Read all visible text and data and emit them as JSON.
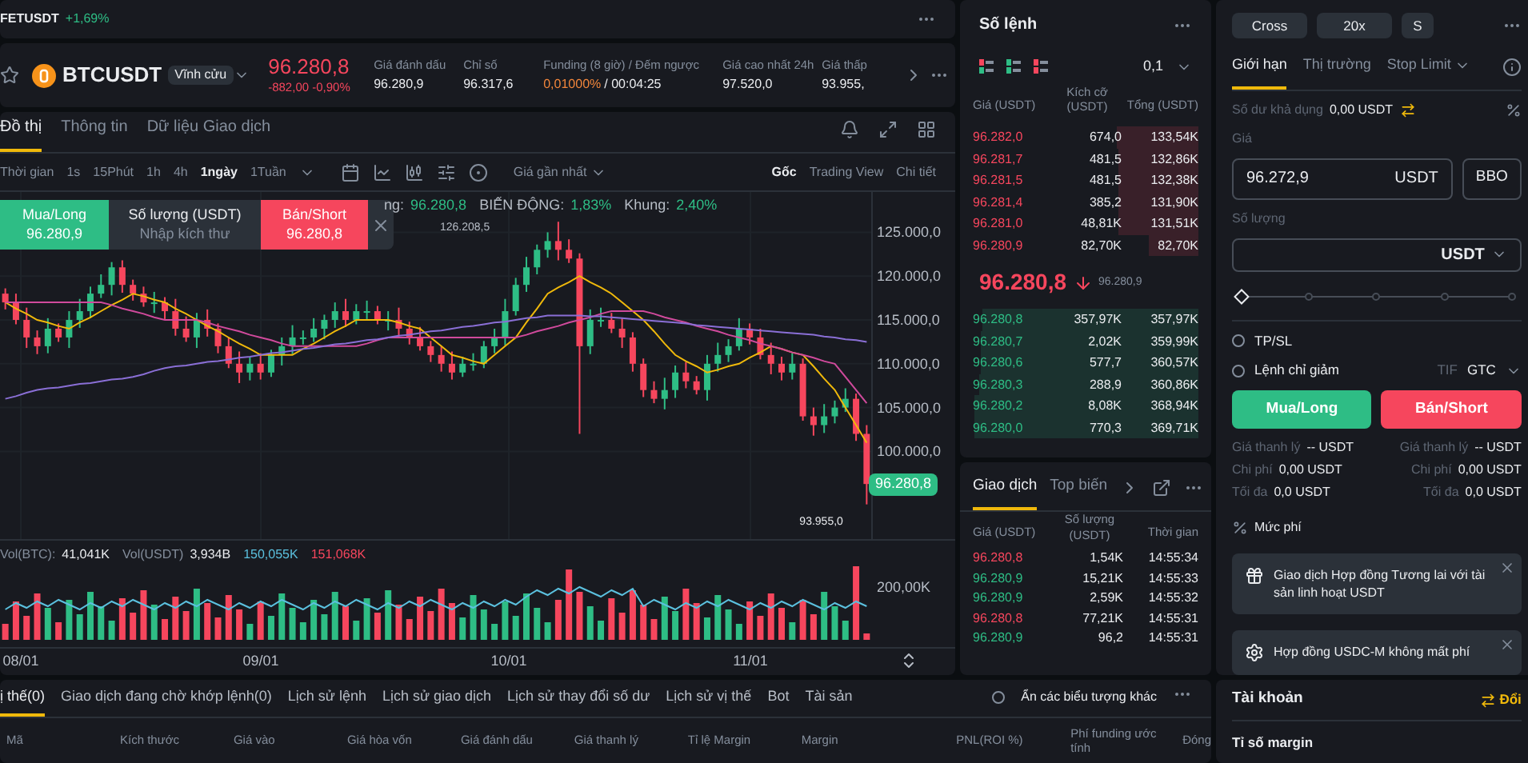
{
  "ticker_strip": {
    "symbol": "FETUSDT",
    "change": "+1,69%"
  },
  "header": {
    "symbol": "BTCUSDT",
    "contract": "Vĩnh cửu",
    "price": "96.280,8",
    "change": "-882,00 -0,90%",
    "stats": [
      {
        "label": "Giá đánh dấu",
        "value": "96.280,9"
      },
      {
        "label": "Chỉ số",
        "value": "96.317,6"
      },
      {
        "label": "Funding (8 giờ) / Đếm ngược",
        "value": "0,01000%",
        "countdown": "/ 00:04:25"
      },
      {
        "label": "Giá cao nhất 24h",
        "value": "97.520,0"
      },
      {
        "label": "Giá thấp",
        "value": "93.955,"
      }
    ]
  },
  "chart_tabs": [
    {
      "label": "Đồ thị",
      "selected": true
    },
    {
      "label": "Thông tin",
      "selected": false
    },
    {
      "label": "Dữ liệu Giao dịch",
      "selected": false
    }
  ],
  "intervals": [
    {
      "label": "Thời gian",
      "selected": false
    },
    {
      "label": "1s",
      "selected": false
    },
    {
      "label": "15Phút",
      "selected": false
    },
    {
      "label": "1h",
      "selected": false
    },
    {
      "label": "4h",
      "selected": false
    },
    {
      "label": "1ngày",
      "selected": true
    },
    {
      "label": "1Tuần",
      "selected": false
    }
  ],
  "price_source": "Giá gần nhất",
  "views": [
    {
      "label": "Gốc",
      "selected": true
    },
    {
      "label": "Trading View",
      "selected": false
    },
    {
      "label": "Chi tiết",
      "selected": false
    }
  ],
  "quick_trade": {
    "buy_label": "Mua/Long",
    "buy_price": "96.280,9",
    "qty_label": "Số lượng (USDT)",
    "qty_placeholder": "Nhập kích thư",
    "sell_label": "Bán/Short",
    "sell_price": "96.280,8"
  },
  "chart_legend": [
    {
      "label": "ng:",
      "value": "96.280,8"
    },
    {
      "label": "BIẾN ĐỘNG:",
      "value": "1,83%"
    },
    {
      "label": "Khung:",
      "value": "2,40%"
    }
  ],
  "chart_data": {
    "type": "candlestick",
    "grid": true,
    "ylim": [
      90000,
      129600
    ],
    "yticks": [
      {
        "value": 125000,
        "label": "125.000,0"
      },
      {
        "value": 120000,
        "label": "120.000,0"
      },
      {
        "value": 115000,
        "label": "115.000,0"
      },
      {
        "value": 110000,
        "label": "110.000,0"
      },
      {
        "value": 105000,
        "label": "105.000,0"
      },
      {
        "value": 100000,
        "label": "100.000,0"
      }
    ],
    "ohlc": [
      [
        118000,
        118600,
        116200,
        117000
      ],
      [
        117000,
        118000,
        114500,
        115000
      ],
      [
        115000,
        116400,
        111800,
        113000
      ],
      [
        113000,
        113800,
        111100,
        112000
      ],
      [
        112000,
        115200,
        111200,
        114000
      ],
      [
        114000,
        114600,
        112500,
        113000
      ],
      [
        113000,
        116000,
        111800,
        115000
      ],
      [
        115000,
        117400,
        114100,
        116000
      ],
      [
        116000,
        118800,
        115200,
        118000
      ],
      [
        118000,
        120200,
        117500,
        119000
      ],
      [
        119000,
        121600,
        117800,
        121000
      ],
      [
        121000,
        121800,
        118100,
        119000
      ],
      [
        119000,
        119600,
        117200,
        118000
      ],
      [
        118000,
        118800,
        116500,
        117000
      ],
      [
        117000,
        118200,
        115800,
        117000
      ],
      [
        117000,
        117600,
        115100,
        116000
      ],
      [
        116000,
        117400,
        113200,
        114000
      ],
      [
        114000,
        115400,
        112500,
        113000
      ],
      [
        113000,
        115800,
        111800,
        115000
      ],
      [
        115000,
        116200,
        113100,
        114000
      ],
      [
        114000,
        114600,
        111200,
        112000
      ],
      [
        112000,
        113000,
        109500,
        110000
      ],
      [
        110000,
        111400,
        107800,
        109000
      ],
      [
        109000,
        110800,
        108100,
        110000
      ],
      [
        110000,
        111200,
        108200,
        109000
      ],
      [
        109000,
        111600,
        108500,
        111000
      ],
      [
        111000,
        113000,
        109800,
        112000
      ],
      [
        112000,
        114400,
        111100,
        113000
      ],
      [
        113000,
        113800,
        112200,
        113000
      ],
      [
        113000,
        115200,
        112500,
        114000
      ],
      [
        114000,
        115600,
        112800,
        115000
      ],
      [
        115000,
        117000,
        114100,
        116000
      ],
      [
        116000,
        117400,
        114200,
        115000
      ],
      [
        115000,
        116800,
        114500,
        116000
      ],
      [
        116000,
        117200,
        115100,
        116000
      ],
      [
        116000,
        116600,
        114500,
        115000
      ],
      [
        115000,
        116000,
        113800,
        115000
      ],
      [
        115000,
        116400,
        113100,
        114000
      ],
      [
        114000,
        114800,
        112200,
        113000
      ],
      [
        113000,
        114200,
        111500,
        112000
      ],
      [
        112000,
        112600,
        110200,
        111000
      ],
      [
        111000,
        112000,
        109100,
        110000
      ],
      [
        110000,
        111400,
        108200,
        109000
      ],
      [
        109000,
        110800,
        108500,
        110000
      ],
      [
        110000,
        111200,
        109200,
        110000
      ],
      [
        110000,
        112600,
        109500,
        112000
      ],
      [
        112000,
        114000,
        111200,
        113000
      ],
      [
        113000,
        117400,
        112100,
        116000
      ],
      [
        116000,
        119800,
        115500,
        119000
      ],
      [
        119000,
        122200,
        118200,
        121000
      ],
      [
        121000,
        123600,
        120200,
        123000
      ],
      [
        123000,
        125000,
        122100,
        124000
      ],
      [
        124000,
        126200,
        121800,
        123000
      ],
      [
        123000,
        124200,
        121500,
        122000
      ],
      [
        122000,
        122600,
        102000,
        112000
      ],
      [
        112000,
        116200,
        111100,
        115000
      ],
      [
        115000,
        116400,
        114200,
        115000
      ],
      [
        115000,
        115800,
        113500,
        114000
      ],
      [
        114000,
        115200,
        111800,
        113000
      ],
      [
        113000,
        113600,
        109100,
        110000
      ],
      [
        110000,
        110600,
        106200,
        107000
      ],
      [
        107000,
        108000,
        105500,
        106000
      ],
      [
        106000,
        108400,
        104800,
        107000
      ],
      [
        107000,
        109800,
        106100,
        109000
      ],
      [
        109000,
        110200,
        107200,
        108000
      ],
      [
        108000,
        108600,
        106500,
        107000
      ],
      [
        107000,
        111000,
        105800,
        110000
      ],
      [
        110000,
        112400,
        109100,
        111000
      ],
      [
        111000,
        112800,
        110200,
        112000
      ],
      [
        112000,
        115200,
        111500,
        114000
      ],
      [
        114000,
        114600,
        112200,
        113000
      ],
      [
        113000,
        114000,
        110500,
        111000
      ],
      [
        111000,
        112400,
        108800,
        110000
      ],
      [
        110000,
        110800,
        108100,
        109000
      ],
      [
        109000,
        111200,
        108200,
        110000
      ],
      [
        110000,
        110600,
        103500,
        104000
      ],
      [
        104000,
        105000,
        101800,
        103000
      ],
      [
        103000,
        105400,
        102100,
        104000
      ],
      [
        104000,
        105800,
        103200,
        105000
      ],
      [
        105000,
        107200,
        104500,
        106000
      ],
      [
        106000,
        106600,
        101200,
        102000
      ],
      [
        102000,
        103000,
        93955,
        96280.8
      ]
    ],
    "series": [
      {
        "type": "line",
        "color": "#f0b90b",
        "values": [
          117000,
          116300,
          115700,
          115000,
          114700,
          114300,
          114000,
          114700,
          115300,
          116000,
          116700,
          117300,
          118000,
          117700,
          117300,
          117000,
          116300,
          115700,
          115000,
          114300,
          113700,
          113000,
          112300,
          111700,
          111000,
          111000,
          111000,
          111000,
          111700,
          112300,
          113000,
          113700,
          114300,
          115000,
          115000,
          115000,
          115000,
          114700,
          114300,
          114000,
          113000,
          112000,
          111000,
          110700,
          110300,
          110000,
          111000,
          112000,
          113000,
          114700,
          116300,
          118000,
          118700,
          119300,
          120000,
          119300,
          118700,
          118000,
          117000,
          116000,
          115000,
          113700,
          112300,
          111000,
          110300,
          109700,
          109000,
          109300,
          109700,
          110000,
          110700,
          111300,
          112000,
          111700,
          111300,
          111000,
          109700,
          108300,
          107000,
          105000,
          103000,
          101000
        ]
      },
      {
        "type": "line",
        "color": "#d04a9c",
        "values": [
          117000,
          117000,
          117000,
          117000,
          117000,
          117000,
          117000,
          117000,
          117000,
          117000,
          116700,
          116300,
          116000,
          115700,
          115300,
          115000,
          115000,
          115000,
          115000,
          114700,
          114300,
          114000,
          113700,
          113300,
          113000,
          112700,
          112300,
          112000,
          112000,
          112000,
          112000,
          112000,
          112000,
          112000,
          112300,
          112700,
          113000,
          113000,
          113000,
          113000,
          113000,
          113000,
          113000,
          113000,
          113000,
          113000,
          113000,
          113000,
          113000,
          113300,
          113700,
          114000,
          114300,
          114700,
          115000,
          115300,
          115700,
          116000,
          116000,
          116000,
          116000,
          115700,
          115300,
          115000,
          114700,
          114300,
          114000,
          113700,
          113300,
          113000,
          112700,
          112300,
          112000,
          111700,
          111300,
          111000,
          110700,
          110300,
          110000,
          108500,
          107000,
          105500
        ]
      },
      {
        "type": "line",
        "color": "#8a6fd6",
        "values": [
          106000,
          106300,
          106700,
          107000,
          107200,
          107300,
          107500,
          107700,
          107800,
          108000,
          108200,
          108300,
          108500,
          108800,
          109200,
          109500,
          109700,
          109800,
          110000,
          110200,
          110300,
          110500,
          110700,
          110800,
          111000,
          111200,
          111300,
          111500,
          111700,
          111800,
          112000,
          112200,
          112300,
          112500,
          112700,
          112800,
          113000,
          113200,
          113300,
          113500,
          113700,
          113800,
          114000,
          114200,
          114300,
          114500,
          114700,
          114800,
          115000,
          115200,
          115300,
          115500,
          115500,
          115500,
          115500,
          115400,
          115400,
          115300,
          115200,
          115100,
          115000,
          114900,
          114800,
          114700,
          114600,
          114400,
          114300,
          114200,
          114100,
          114000,
          113900,
          113800,
          113700,
          113600,
          113500,
          113400,
          113300,
          113100,
          113000,
          112800,
          112700,
          112500
        ]
      }
    ]
  },
  "high_label": "126.208,5",
  "low_label": "93.955,0",
  "last_price_tag": "96.280,8",
  "volume_legend": [
    {
      "label": "Vol(BTC):",
      "value": "41,041K",
      "color": "#eaecef"
    },
    {
      "label": "Vol(USDT)",
      "value": "3,934B",
      "color": "#eaecef"
    },
    {
      "value": "150,055K",
      "color": "#5bc0de"
    },
    {
      "value": "151,068K",
      "color": "#f6465d"
    }
  ],
  "volume_axis": "200,00K",
  "date_axis": [
    "08/01",
    "09/01",
    "10/01",
    "11/01"
  ],
  "order_book": {
    "title": "Số lệnh",
    "tick": "0,1",
    "columns": [
      "Giá (USDT)",
      "Kích cỡ (USDT)",
      "Tổng (USDT)"
    ],
    "asks": [
      {
        "price": "96.282,0",
        "size": "674,0",
        "total": "133,54K"
      },
      {
        "price": "96.281,7",
        "size": "481,5",
        "total": "132,86K"
      },
      {
        "price": "96.281,5",
        "size": "481,5",
        "total": "132,38K"
      },
      {
        "price": "96.281,4",
        "size": "385,2",
        "total": "131,90K"
      },
      {
        "price": "96.281,0",
        "size": "48,81K",
        "total": "131,51K"
      },
      {
        "price": "96.280,9",
        "size": "82,70K",
        "total": "82,70K"
      }
    ],
    "mid": {
      "price": "96.280,8",
      "mark": "96.280,9"
    },
    "bids": [
      {
        "price": "96.280,8",
        "size": "357,97K",
        "total": "357,97K"
      },
      {
        "price": "96.280,7",
        "size": "2,02K",
        "total": "359,99K"
      },
      {
        "price": "96.280,6",
        "size": "577,7",
        "total": "360,57K"
      },
      {
        "price": "96.280,3",
        "size": "288,9",
        "total": "360,86K"
      },
      {
        "price": "96.280,2",
        "size": "8,08K",
        "total": "368,94K"
      },
      {
        "price": "96.280,0",
        "size": "770,3",
        "total": "369,71K"
      }
    ]
  },
  "trades": {
    "tabs": [
      {
        "label": "Giao dịch",
        "selected": true
      },
      {
        "label": "Top biến",
        "selected": false
      }
    ],
    "columns": [
      "Giá (USDT)",
      "Số lượng (USDT)",
      "Thời gian"
    ],
    "rows": [
      {
        "price": "96.280,8",
        "qty": "1,54K",
        "time": "14:55:34",
        "color": "#f6465d"
      },
      {
        "price": "96.280,9",
        "qty": "15,21K",
        "time": "14:55:33",
        "color": "#2ebd85"
      },
      {
        "price": "96.280,9",
        "qty": "2,59K",
        "time": "14:55:32",
        "color": "#2ebd85"
      },
      {
        "price": "96.280,8",
        "qty": "77,21K",
        "time": "14:55:31",
        "color": "#f6465d"
      },
      {
        "price": "96.280,9",
        "qty": "96,2",
        "time": "14:55:31",
        "color": "#2ebd85"
      }
    ]
  },
  "order_form": {
    "mode_buttons": [
      "Cross",
      "20x",
      "S"
    ],
    "tabs": [
      {
        "label": "Giới hạn",
        "selected": true
      },
      {
        "label": "Thị trường",
        "selected": false
      },
      {
        "label": "Stop Limit",
        "selected": false
      }
    ],
    "available_label": "Số dư khả dụng",
    "available_value": "0,00 USDT",
    "price_label": "Giá",
    "price_value": "96.272,9",
    "price_unit": "USDT",
    "bbo": "BBO",
    "qty_label": "Số lượng",
    "qty_unit": "USDT",
    "level": 0,
    "checkboxes": [
      {
        "label": "TP/SL",
        "checked": false
      },
      {
        "label": "Lệnh chỉ giảm",
        "checked": false
      }
    ],
    "tif_label": "TIF",
    "tif_value": "GTC",
    "buy": "Mua/Long",
    "sell": "Bán/Short",
    "buy_info": [
      {
        "label": "Giá thanh lý",
        "value": "-- USDT"
      },
      {
        "label": "Chi phí",
        "value": "0,00 USDT"
      },
      {
        "label": "Tối đa",
        "value": "0,0 USDT"
      }
    ],
    "sell_info": [
      {
        "label": "Giá thanh lý",
        "value": "-- USDT"
      },
      {
        "label": "Chi phí",
        "value": "0,00 USDT"
      },
      {
        "label": "Tối đa",
        "value": "0,0 USDT"
      }
    ],
    "fee": "Mức phí",
    "notices": [
      "Giao dịch Hợp đồng Tương lai với tài sản linh hoạt USDT",
      "Hợp đồng USDC-M không mất phí"
    ]
  },
  "account": {
    "title": "Tài khoản",
    "action": "Đổi",
    "row": "Tỉ số margin"
  },
  "bottom": {
    "tabs": [
      {
        "label": "ị thế(0)",
        "selected": true
      },
      {
        "label": "Giao dịch đang chờ khớp lệnh(0)",
        "selected": false
      },
      {
        "label": "Lịch sử lệnh",
        "selected": false
      },
      {
        "label": "Lịch sử giao dịch",
        "selected": false
      },
      {
        "label": "Lịch sử thay đổi số dư",
        "selected": false
      },
      {
        "label": "Lịch sử vị thế",
        "selected": false
      },
      {
        "label": "Bot",
        "selected": false
      },
      {
        "label": "Tài sản",
        "selected": false
      }
    ],
    "hide_others": {
      "label": "Ẩn các biểu tượng khác",
      "checked": false
    },
    "columns": [
      "Mã",
      "Kích thước",
      "Giá vào",
      "Giá hòa vốn",
      "Giá đánh dấu",
      "Giá thanh lý",
      "Tỉ lệ Margin",
      "Margin",
      "PNL(ROI %)",
      "Phí funding ước tính",
      "Đóng"
    ]
  }
}
